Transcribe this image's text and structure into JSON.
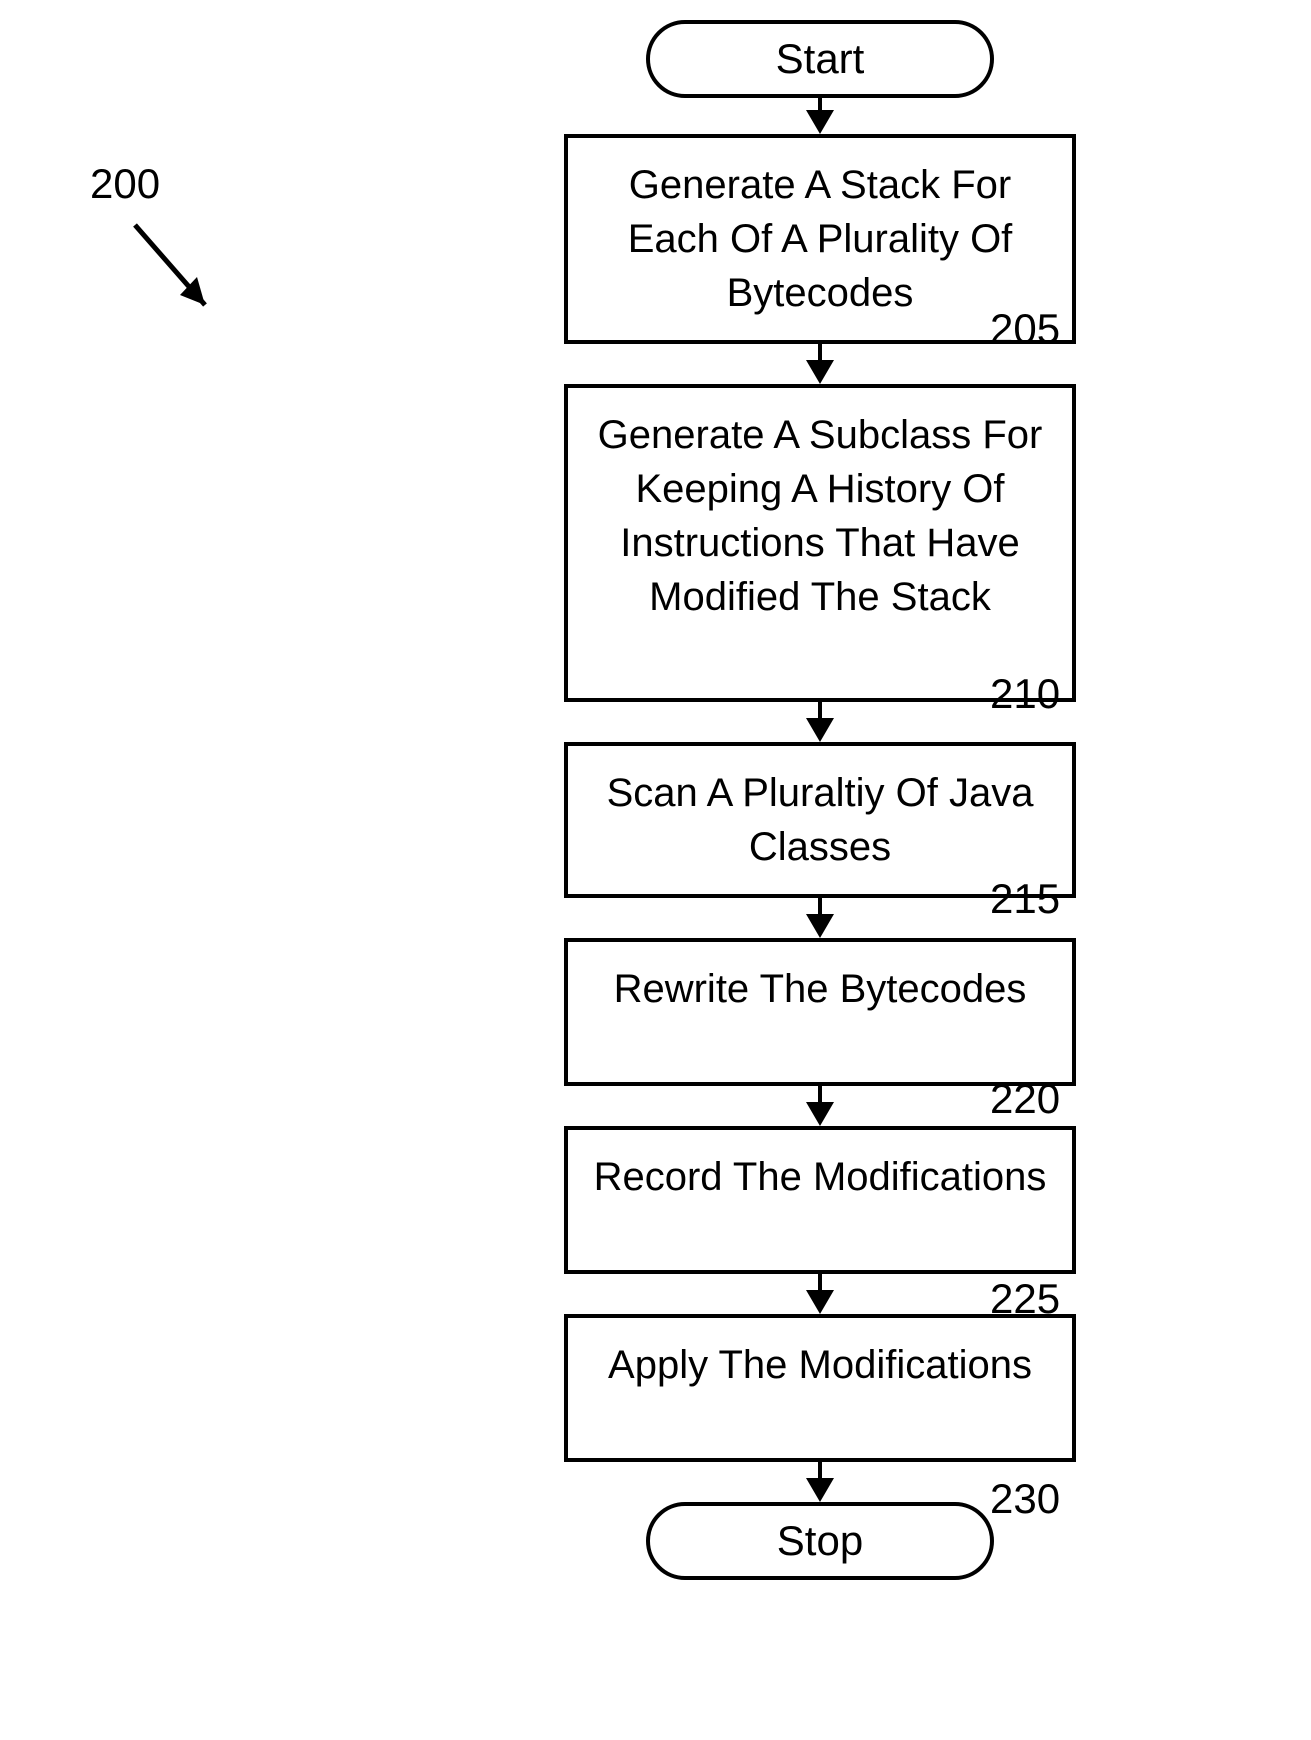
{
  "figureNumber": "200",
  "terminators": {
    "start": "Start",
    "stop": "Stop"
  },
  "steps": [
    {
      "num": "205",
      "text": "Generate A Stack For Each Of A Plurality Of Bytecodes"
    },
    {
      "num": "210",
      "text": "Generate A Subclass For Keeping A History Of Instructions That Have Modified The Stack"
    },
    {
      "num": "215",
      "text": "Scan A Pluraltiy Of Java Classes"
    },
    {
      "num": "220",
      "text": "Rewrite The Bytecodes"
    },
    {
      "num": "225",
      "text": "Record The Modifications"
    },
    {
      "num": "230",
      "text": "Apply The Modifications"
    }
  ]
}
